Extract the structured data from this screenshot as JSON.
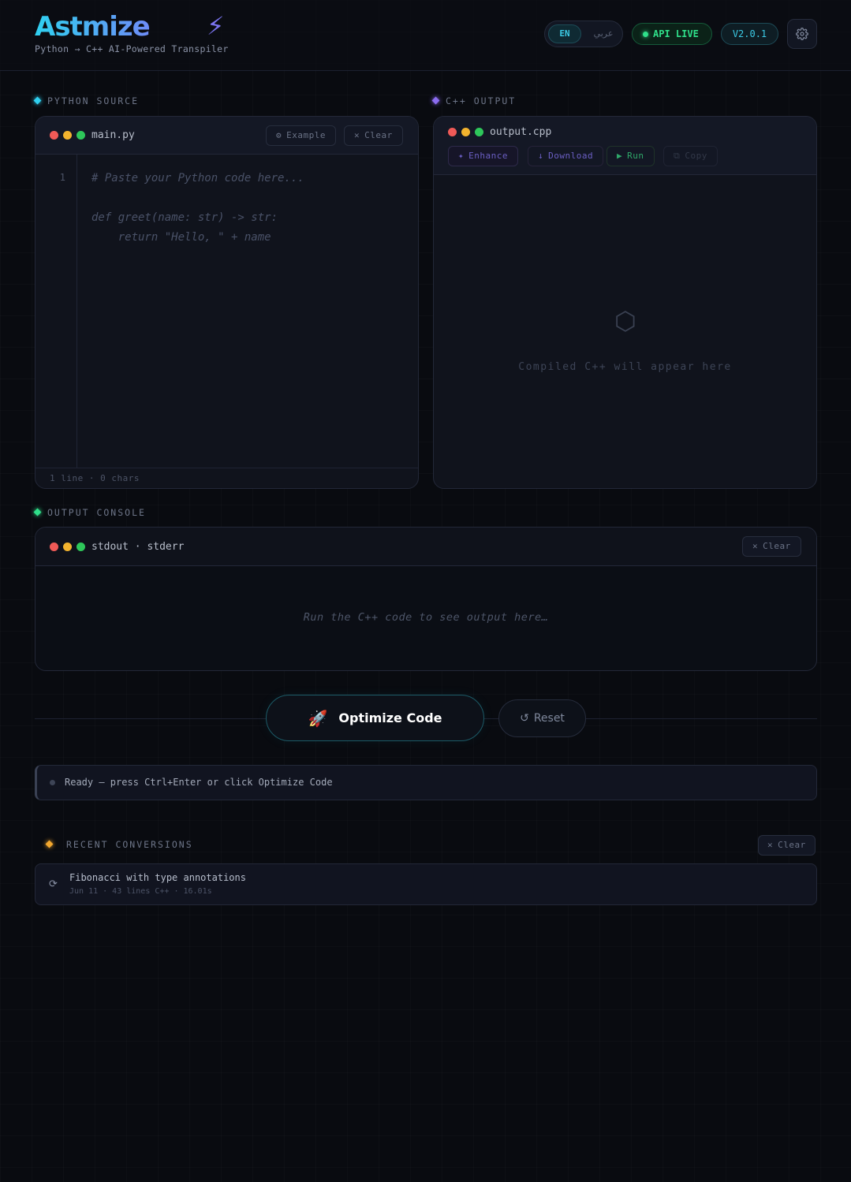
{
  "header": {
    "logo": "Astmize",
    "logo_icon": "bolt-icon",
    "subtitle": "Python → C++ AI-Powered Transpiler",
    "lang_en": "EN",
    "lang_ar": "عربي",
    "api_status": "API LIVE",
    "version": "V2.0.1"
  },
  "python": {
    "section_label": "PYTHON SOURCE",
    "filename": "main.py",
    "example_label": "Example",
    "clear_label": "Clear",
    "line_number": "1",
    "placeholder": "# Paste your Python code here...\n\ndef greet(name: str) -> str:\n    return \"Hello, \" + name",
    "status": "1 line  ·  0 chars"
  },
  "cpp": {
    "section_label": "C++ OUTPUT",
    "filename": "output.cpp",
    "enhance_label": "Enhance",
    "download_label": "Download",
    "run_label": "Run",
    "copy_label": "Copy",
    "placeholder": "Compiled C++ will appear here"
  },
  "console": {
    "section_label": "OUTPUT CONSOLE",
    "title": "stdout · stderr",
    "clear_label": "Clear",
    "empty_text": "Run the C++ code to see output here…"
  },
  "actions": {
    "optimize_label": "Optimize Code",
    "reset_label": "Reset"
  },
  "status": {
    "text": "Ready — press Ctrl+Enter or click Optimize Code"
  },
  "recent": {
    "section_label": "RECENT CONVERSIONS",
    "clear_label": "Clear",
    "items": [
      {
        "title": "Fibonacci with type annotations",
        "meta": "Jun 11 · 43 lines C++ · 16.01s"
      }
    ]
  },
  "colors": {
    "accent_cyan": "#3ccbe6",
    "accent_purple": "#8b6cf0",
    "live_green": "#2fe08a",
    "warning_amber": "#f2a72e"
  }
}
